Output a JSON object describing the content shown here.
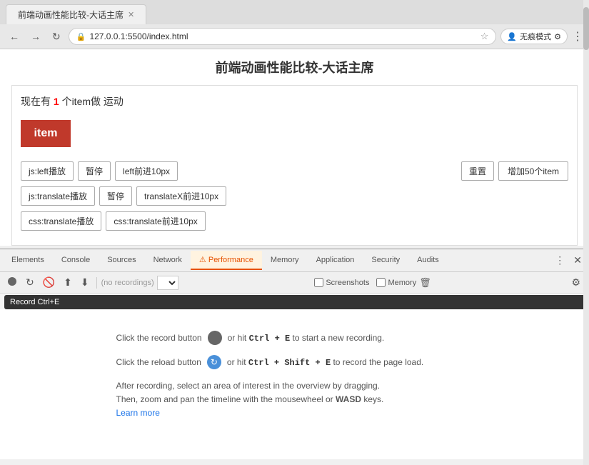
{
  "browser": {
    "tab_label": "前端动画性能比较-大话主席",
    "url": "127.0.0.1:5500/index.html",
    "mode_button": "无痕模式"
  },
  "page": {
    "title": "前端动画性能比较-大话主席",
    "status_prefix": "现在有 ",
    "status_count": "1",
    "status_suffix": " 个item做  运动",
    "item_label": "item",
    "buttons": {
      "js_left_play": "js:left播放",
      "pause1": "暂停",
      "left10px": "left前进10px",
      "js_translate_play": "js:translate播放",
      "pause2": "暂停",
      "translateX10px": "translateX前进10px",
      "css_translate_play": "css:translate播放",
      "css_translate_forward": "css:translate前进10px",
      "reset": "重置",
      "add50": "增加50个item"
    }
  },
  "devtools": {
    "tabs": [
      {
        "label": "Elements",
        "active": false
      },
      {
        "label": "Console",
        "active": false
      },
      {
        "label": "Sources",
        "active": false
      },
      {
        "label": "Network",
        "active": false
      },
      {
        "label": "Performance",
        "active": true,
        "warn": true
      },
      {
        "label": "Memory",
        "active": false
      },
      {
        "label": "Application",
        "active": false
      },
      {
        "label": "Security",
        "active": false
      },
      {
        "label": "Audits",
        "active": false
      }
    ],
    "toolbar": {
      "no_recordings": "(no recordings)",
      "screenshots_label": "Screenshots",
      "memory_label": "Memory"
    },
    "tooltip": "Record",
    "tooltip_shortcut": "Ctrl+E",
    "instructions": [
      {
        "type": "record",
        "text_before": "Click the record button",
        "text_after": "or hit ",
        "shortcut": "Ctrl + E",
        "text_end": " to start a new recording."
      },
      {
        "type": "reload",
        "text_before": "Click the reload button",
        "text_after": "or hit ",
        "shortcut": "Ctrl + Shift + E",
        "text_end": " to record the page load."
      }
    ],
    "after_recording_text": "After recording, select an area of interest in the overview by dragging.\nThen, zoom and pan the timeline with the mousewheel or ",
    "wasd": "WASD",
    "after_wasd": " keys.",
    "learn_more": "Learn more"
  }
}
